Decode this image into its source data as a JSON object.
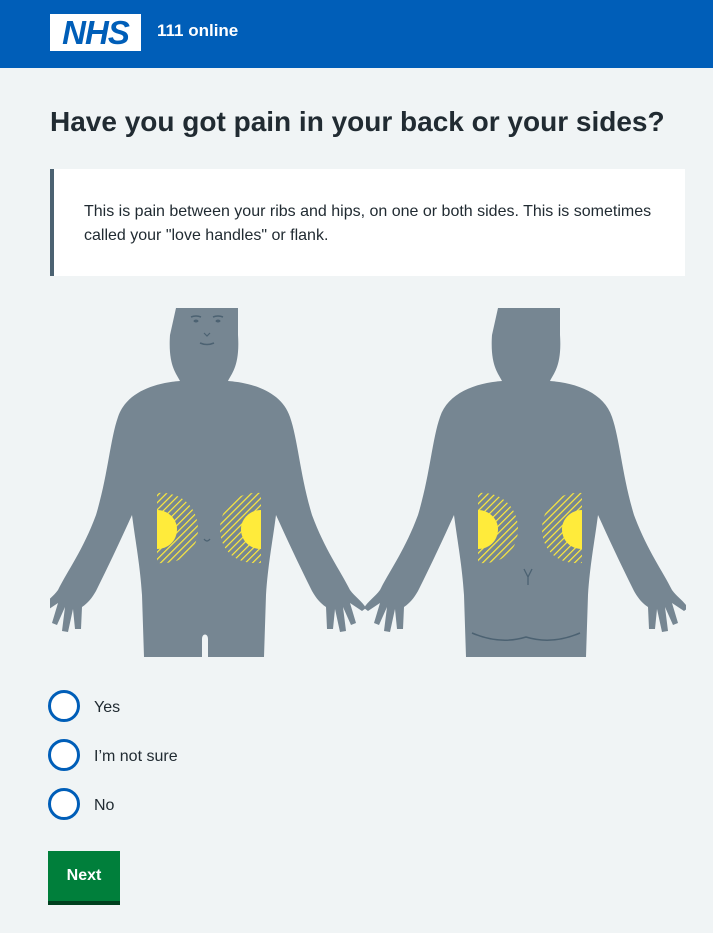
{
  "header": {
    "logo_text": "NHS",
    "service_name": "111 online"
  },
  "question": {
    "title": "Have you got pain in your back or your sides?",
    "hint": "This is pain between your ribs and hips, on one or both sides. This is sometimes called your \"love handles\" or flank."
  },
  "options": [
    {
      "label": "Yes"
    },
    {
      "label": "I’m not sure"
    },
    {
      "label": "No"
    }
  ],
  "next_button_label": "Next",
  "colors": {
    "header_blue": "#005eb8",
    "body_grey": "#768692",
    "pain_yellow": "#ffeb3b",
    "button_green": "#007f3b"
  }
}
